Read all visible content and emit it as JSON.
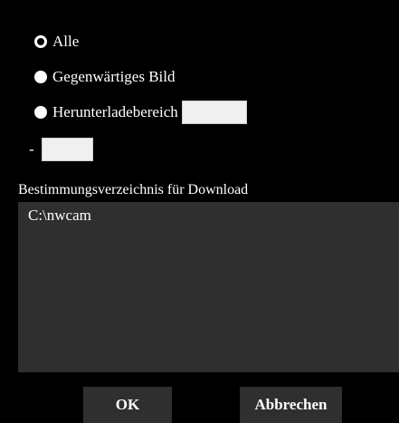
{
  "options": {
    "all_label": "Alle",
    "current_label": "Gegenwärtiges Bild",
    "range_label": "Herunterladebereich",
    "range_separator": "-",
    "range_from_value": "",
    "range_to_value": "",
    "selected": "all"
  },
  "destination": {
    "label": "Bestimmungsverzeichnis für Download",
    "path": "C:\\nwcam"
  },
  "buttons": {
    "ok_label": "OK",
    "cancel_label": "Abbrechen"
  },
  "colors": {
    "background": "#000000",
    "panel": "#2f2f2f",
    "text": "#ffffff",
    "input": "#f0f0f0"
  }
}
